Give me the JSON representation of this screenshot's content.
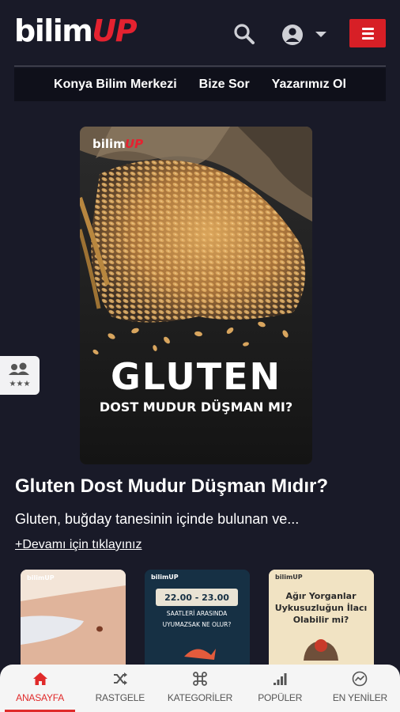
{
  "header": {
    "logo_main": "bilim",
    "logo_accent": "UP",
    "menu_label": "Menu"
  },
  "topnav": [
    {
      "label": "Konya Bilim Merkezi"
    },
    {
      "label": "Bize Sor"
    },
    {
      "label": "Yazarımız Ol"
    }
  ],
  "hero": {
    "badge_main": "bilim",
    "badge_accent": "UP",
    "headline": "GLUTEN",
    "subheadline": "DOST MUDUR DÜŞMAN MI?"
  },
  "article": {
    "title": "Gluten Dost Mudur Düşman Mıdır?",
    "excerpt": "Gluten, buğday tanesinin içinde bulunan ve...",
    "more_link": "+Devamı için tıklayınız"
  },
  "cards": [
    {
      "badge": "bilimUP"
    },
    {
      "badge": "bilimUP",
      "line1": "22.00 - 23.00",
      "line2": "SAATLERİ ARASINDA",
      "line3": "UYUMAZSAK NE OLUR?"
    },
    {
      "badge": "bilimUP",
      "line1": "Ağır Yorganlar",
      "line2": "Uykusuzluğun İlacı",
      "line3": "Olabilir mi?"
    }
  ],
  "bottom_nav": [
    {
      "label": "ANASAYFA",
      "icon": "home-icon",
      "active": true
    },
    {
      "label": "RASTGELE",
      "icon": "shuffle-icon",
      "active": false
    },
    {
      "label": "KATEGORİLER",
      "icon": "command-icon",
      "active": false
    },
    {
      "label": "POPÜLER",
      "icon": "signal-icon",
      "active": false
    },
    {
      "label": "EN YENİLER",
      "icon": "trend-icon",
      "active": false
    }
  ],
  "colors": {
    "background": "#191a28",
    "accent": "#e52230",
    "active_tab": "#e02a2a"
  }
}
